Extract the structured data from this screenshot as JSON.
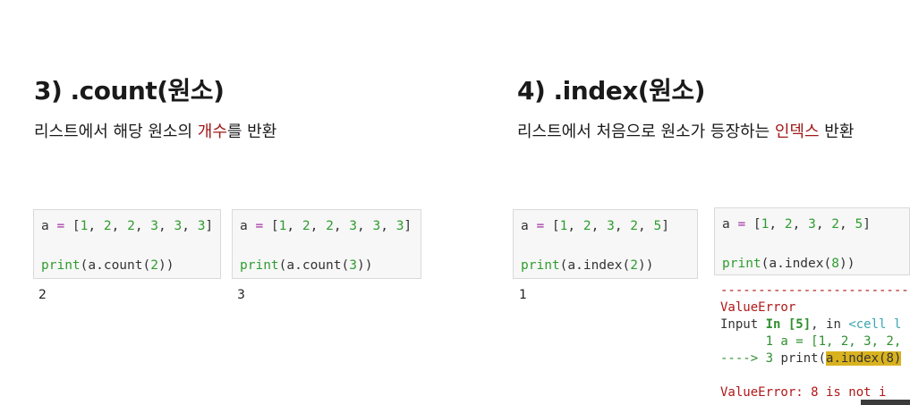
{
  "left": {
    "heading": "3) .count(원소)",
    "desc_pre": "리스트에서 해당 원소의 ",
    "desc_highlight": "개수",
    "desc_post": "를 반환",
    "cells": [
      {
        "line1": "a = [1, 2, 2, 3, 3, 3]",
        "line2": "print(a.count(2))",
        "output": "2"
      },
      {
        "line1": "a = [1, 2, 2, 3, 3, 3]",
        "line2": "print(a.count(3))",
        "output": "3"
      }
    ]
  },
  "right": {
    "heading": "4) .index(원소)",
    "desc_pre": "리스트에서 처음으로 원소가 등장하는 ",
    "desc_highlight": "인덱스",
    "desc_post": " 반환",
    "cells": [
      {
        "line1": "a = [1, 2, 3, 2, 5]",
        "line2": "print(a.index(2))",
        "output": "1"
      },
      {
        "line1": "a = [1, 2, 3, 2, 5]",
        "line2": "print(a.index(8))"
      }
    ],
    "traceback": {
      "dashes": "---------------------------",
      "error_name": "ValueError",
      "input_pre": "Input ",
      "input_in": "In [5]",
      "input_post": ", in ",
      "input_cell": "<cell l",
      "line1": "      1 a = [1, 2, 3, 2,",
      "arrow": "----> 3 ",
      "arrow_code": "print(",
      "arrow_hl": "a.index(8)",
      "final": "ValueError: 8 is not i"
    }
  }
}
